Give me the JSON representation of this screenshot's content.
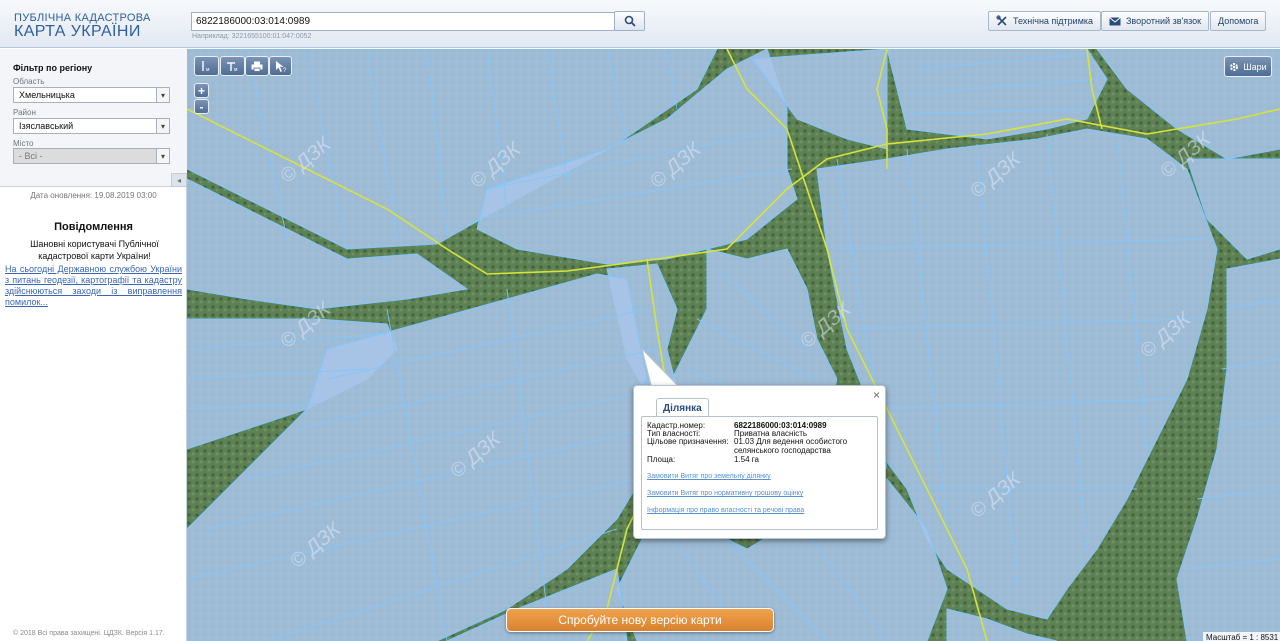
{
  "header": {
    "logo_line1": "ПУБЛІЧНА КАДАСТРОВА",
    "logo_line2": "КАРТА УКРАЇНИ",
    "search_value": "6822186000:03:014:0989",
    "search_hint": "Наприклад: 3221655100:01:047:0052",
    "search_icon": "search-icon",
    "buttons": [
      {
        "label": "Технічна підтримка",
        "icon": "tools-icon"
      },
      {
        "label": "Зворотний зв'язок",
        "icon": "envelope-icon"
      },
      {
        "label": "Допомога",
        "icon": ""
      }
    ]
  },
  "sidebar": {
    "filter_title": "Фільтр по регіону",
    "region_label": "Область",
    "region_value": "Хмельницька",
    "district_label": "Район",
    "district_value": "Ізяславський",
    "city_label": "Місто",
    "city_value": "- Всі -",
    "collapse_icon": "◂",
    "update_date": "Дата оновлення: 19.08.2019 03:00",
    "notification_title": "Повідомлення",
    "notification_text": "Шановні користувачі Публічної кадастрової карти України!",
    "notification_link": "На сьогодні Державною службою України з питань геодезії, картографії та кадастру здійснюються заходи із виправлення помилок...",
    "copyright": "© 2018 Всі права захищені. ЦДЗК. Версія 1.17."
  },
  "map": {
    "layers_label": "Шари",
    "zoom_in": "+",
    "zoom_out": "-",
    "scale_text": "Масштаб = 1 : 8531",
    "new_version_label": "Спробуйте нову версію карти",
    "watermark": "© ДЗК",
    "tools": [
      "measure-length-icon",
      "measure-area-icon",
      "print-icon",
      "identify-icon"
    ]
  },
  "popup": {
    "tab_label": "Ділянка",
    "close_icon": "×",
    "fields": [
      {
        "key": "Кадастр.номер:",
        "value": "6822186000:03:014:0989"
      },
      {
        "key": "Тип власності:",
        "value": "Приватна власність"
      },
      {
        "key": "Цільове призначення:",
        "value": "01.03 Для ведення особистого селянського господарства"
      },
      {
        "key": "Площа:",
        "value": "1.54 га"
      }
    ],
    "links": [
      "Замовити Витяг про земельну ділянку",
      "Замовити Витяг про нормативну грошову оцінку",
      "Інформація про право власності та речові права"
    ]
  },
  "colors": {
    "header_title": "#2f5f9e",
    "parcel_fill": "#a9c4e8",
    "parcel_stroke": "#7fc7ff",
    "boundary_line": "#d6e43a",
    "new_version_btn": "#e8923f"
  }
}
